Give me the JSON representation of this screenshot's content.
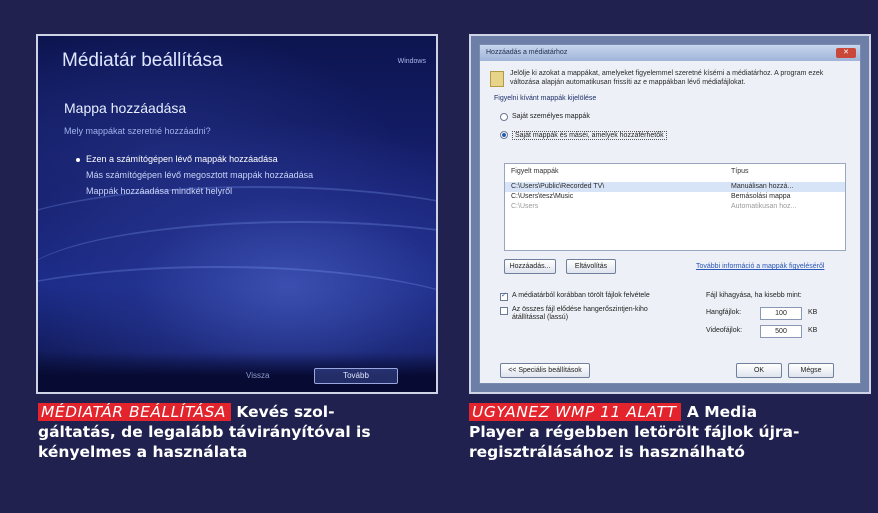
{
  "left": {
    "title": "Médiatár beállítása",
    "brand": "Windows",
    "heading": "Mappa hozzáadása",
    "question": "Mely mappákat szeretné hozzáadni?",
    "options": [
      "Ezen a számítógépen lévő mappák hozzáadása",
      "Más számítógépen lévő megosztott mappák hozzáadása",
      "Mappák hozzáadása mindkét helyről"
    ],
    "back": "Vissza",
    "next": "Tovább"
  },
  "right": {
    "title": "Hozzáadás a médiatárhoz",
    "close": "✕",
    "intro": "Jelölje ki azokat a mappákat, amelyeket figyelemmel szeretné kísérni a médiatárhoz. A program ezek változása alapján automatikusan frissíti az e mappákban lévő médiafájlokat.",
    "group_label": "Figyelni kívánt mappák kijelölése",
    "radio_own": "Saját személyes mappák",
    "radio_all": "Saját mappák és máséi, amelyek hozzáférhetők",
    "col_folder": "Figyelt mappák",
    "col_type": "Típus",
    "rows": [
      {
        "folder": "C:\\Users\\Public\\Recorded TV\\",
        "type": "Manuálisan hozzá..."
      },
      {
        "folder": "C:\\Users\\tesz\\Music",
        "type": "Bemásolási mappa"
      },
      {
        "folder": "C:\\Users",
        "type": "Automatikusan hoz..."
      }
    ],
    "add_button": "Hozzáadás...",
    "remove_button": "Eltávolítás",
    "link": "További információ a mappák figyeléséről",
    "check1": "A médiatárból korábban törölt fájlok felvétele",
    "check2": "Az összes fájl elődése hangerőszintjen-kiho átállítással (lassú)",
    "size_label": "Fájl kihagyása, ha kisebb mint:",
    "audio_label": "Hangfájlok:",
    "audio_value": "100",
    "video_label": "Videofájlok:",
    "video_value": "500",
    "unit": "KB",
    "advanced_button": "<< Speciális beállítások",
    "ok_button": "OK",
    "cancel_button": "Mégse"
  },
  "captions": {
    "left_tag": "MÉDIATÁR BEÁLLÍTÁSA",
    "left_line1": "Kevés szol-",
    "left_line2": "gáltatás, de legalább távirányítóval is",
    "left_line3": "kényelmes a használata",
    "right_tag": "UGYANEZ WMP 11 ALATT",
    "right_line1": "A Media",
    "right_line2": "Player a régebben letörölt fájlok újra-",
    "right_line3": "regisztrálásához is használható"
  }
}
